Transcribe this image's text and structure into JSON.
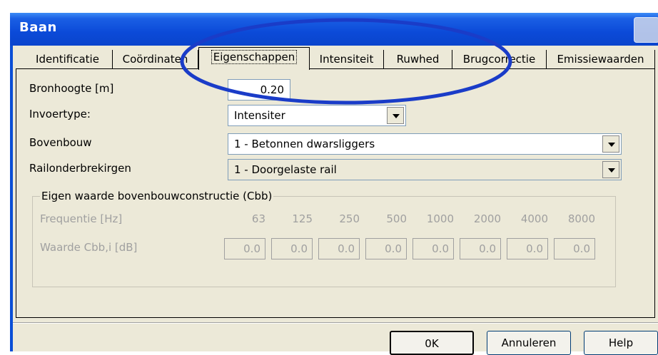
{
  "window": {
    "title": "Baan"
  },
  "tabs": [
    "Identificatie",
    "Coördinaten",
    "Eigenschappen",
    "Intensiteit",
    "Ruwhed",
    "Brugcorrectie",
    "Emissiewaarden"
  ],
  "form": {
    "bronhoogte": {
      "label": "Bronhoogte [m]",
      "value": "0.20"
    },
    "invoertype": {
      "label": "Invoertype:",
      "value": "Intensiter"
    },
    "bovenbouw": {
      "label": "Bovenbouw",
      "value": "1 - Betonnen dwarsliggers"
    },
    "railonderbrekingen": {
      "label": "Railonderbrekirgen",
      "value": "1 - Doorgelaste rail"
    }
  },
  "group": {
    "title": "Eigen waarde bovenbouwconstructie (Cbb)",
    "freq_label": "Frequentie [Hz]",
    "waarde_label": "Waarde Cbb,i [dB]",
    "frequencies": [
      "63",
      "125",
      "250",
      "500",
      "1000",
      "2000",
      "4000",
      "8000"
    ],
    "values": [
      "0.0",
      "0.0",
      "0.0",
      "0.0",
      "0.0",
      "0.0",
      "0.0",
      "0.0"
    ]
  },
  "buttons": {
    "ok": "0K",
    "cancel": "Annuleren",
    "help": "Help"
  },
  "colors": {
    "titlebar": "#0a4ed6",
    "face": "#ece9d8",
    "annotation": "#1a3cc8"
  }
}
